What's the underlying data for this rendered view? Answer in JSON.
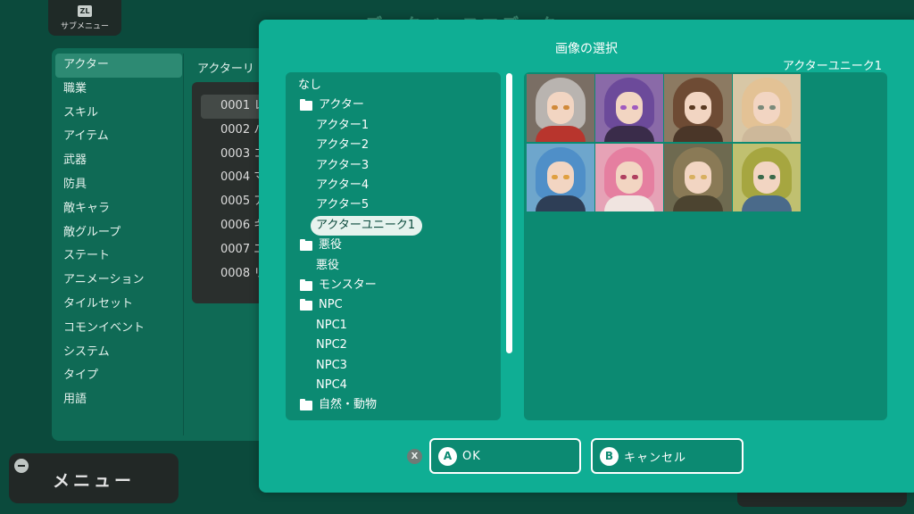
{
  "background": {
    "title": "データベースエディタ",
    "submenu": {
      "badge": "ZL",
      "label": "サブメニュー"
    },
    "db_categories": [
      {
        "label": "アクター",
        "selected": true
      },
      {
        "label": "職業"
      },
      {
        "label": "スキル"
      },
      {
        "label": "アイテム"
      },
      {
        "label": "武器"
      },
      {
        "label": "防具"
      },
      {
        "label": "敵キャラ"
      },
      {
        "label": "敵グループ"
      },
      {
        "label": "ステート"
      },
      {
        "label": "アニメーション"
      },
      {
        "label": "タイルセット"
      },
      {
        "label": "コモンイベント"
      },
      {
        "label": "システム"
      },
      {
        "label": "タイプ"
      },
      {
        "label": "用語"
      }
    ],
    "actor_list_title": "アクターリ",
    "actors": [
      "0001 レ",
      "0002 ハ",
      "0003 コ",
      "0004 マ",
      "0005 ア",
      "0006 キ",
      "0007 エ",
      "0008 リ"
    ],
    "menu_button": "メニュー"
  },
  "dialog": {
    "title": "画像の選択",
    "selected_name": "アクターユニーク1",
    "tree": [
      {
        "label": "なし",
        "level": 0,
        "folder": false
      },
      {
        "label": "アクター",
        "level": 1,
        "folder": true
      },
      {
        "label": "アクター1",
        "level": 2,
        "folder": false
      },
      {
        "label": "アクター2",
        "level": 2,
        "folder": false
      },
      {
        "label": "アクター3",
        "level": 2,
        "folder": false
      },
      {
        "label": "アクター4",
        "level": 2,
        "folder": false
      },
      {
        "label": "アクター5",
        "level": 2,
        "folder": false
      },
      {
        "label": "アクターユニーク1",
        "level": 2,
        "folder": false,
        "selected": true
      },
      {
        "label": "悪役",
        "level": 1,
        "folder": true
      },
      {
        "label": "悪役",
        "level": 2,
        "folder": false
      },
      {
        "label": "モンスター",
        "level": 1,
        "folder": true
      },
      {
        "label": "NPC",
        "level": 1,
        "folder": true
      },
      {
        "label": "NPC1",
        "level": 2,
        "folder": false
      },
      {
        "label": "NPC2",
        "level": 2,
        "folder": false
      },
      {
        "label": "NPC3",
        "level": 2,
        "folder": false
      },
      {
        "label": "NPC4",
        "level": 2,
        "folder": false
      },
      {
        "label": "自然・動物",
        "level": 1,
        "folder": true
      }
    ],
    "portraits": [
      {
        "hair": "#b9b4b0",
        "body": "#b8352d",
        "bg": "#7a6e64",
        "eye": "#d18a3a",
        "selected": true
      },
      {
        "hair": "#6c4a9a",
        "body": "#3a2c4a",
        "bg": "#8a6aa8",
        "eye": "#a05abf"
      },
      {
        "hair": "#6e4b34",
        "body": "#4a3628",
        "bg": "#8c7a62",
        "eye": "#5a3a22"
      },
      {
        "hair": "#e3c295",
        "body": "#cdb89a",
        "bg": "#d8c7a6",
        "eye": "#7a8a7a"
      },
      {
        "hair": "#4f8fc8",
        "body": "#2e3e56",
        "bg": "#6ea6cc",
        "eye": "#e0a040"
      },
      {
        "hair": "#e57fa0",
        "body": "#f0e4e0",
        "bg": "#e6a2b6",
        "eye": "#b04060"
      },
      {
        "hair": "#8a7a56",
        "body": "#4c4430",
        "bg": "#6e6a50",
        "eye": "#d8b060"
      },
      {
        "hair": "#a6a640",
        "body": "#4a6a8a",
        "bg": "#c0c070",
        "eye": "#3a6a4a"
      }
    ],
    "x_badge": "X",
    "ok_button": {
      "key": "A",
      "label": "OK"
    },
    "cancel_button": {
      "key": "B",
      "label": "キャンセル"
    }
  }
}
